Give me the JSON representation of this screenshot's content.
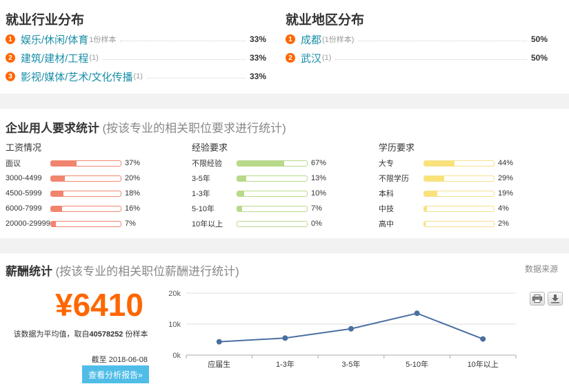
{
  "industry": {
    "title": "就业行业分布",
    "items": [
      {
        "rank": "1",
        "name": "娱乐/休闲/体育",
        "count": "1份样本",
        "pct": "33%"
      },
      {
        "rank": "2",
        "name": "建筑/建材/工程",
        "count": "(1)",
        "pct": "33%"
      },
      {
        "rank": "3",
        "name": "影视/媒体/艺术/文化传播",
        "count": "(1)",
        "pct": "33%"
      }
    ]
  },
  "region": {
    "title": "就业地区分布",
    "items": [
      {
        "rank": "1",
        "name": "成都",
        "count": "(1份样本)",
        "pct": "50%"
      },
      {
        "rank": "2",
        "name": "武汉",
        "count": "(1)",
        "pct": "50%"
      }
    ]
  },
  "requirements": {
    "title": "企业用人要求统计",
    "subtitle": "(按该专业的相关职位要求进行统计)",
    "groups": [
      {
        "title": "工资情况",
        "color": "#f0846e",
        "border": "#f0846e",
        "rows": [
          {
            "label": "面议",
            "value": 37,
            "pct": "37%"
          },
          {
            "label": "3000-4499",
            "value": 20,
            "pct": "20%"
          },
          {
            "label": "4500-5999",
            "value": 18,
            "pct": "18%"
          },
          {
            "label": "6000-7999",
            "value": 16,
            "pct": "16%"
          },
          {
            "label": "20000-29999",
            "value": 7,
            "pct": "7%"
          }
        ]
      },
      {
        "title": "经验要求",
        "color": "#b8d98a",
        "border": "#b8d98a",
        "rows": [
          {
            "label": "不限经验",
            "value": 67,
            "pct": "67%"
          },
          {
            "label": "3-5年",
            "value": 13,
            "pct": "13%"
          },
          {
            "label": "1-3年",
            "value": 10,
            "pct": "10%"
          },
          {
            "label": "5-10年",
            "value": 7,
            "pct": "7%"
          },
          {
            "label": "10年以上",
            "value": 0,
            "pct": "0%"
          }
        ]
      },
      {
        "title": "学历要求",
        "color": "#f9e27a",
        "border": "#f5df8c",
        "rows": [
          {
            "label": "大专",
            "value": 44,
            "pct": "44%"
          },
          {
            "label": "不限学历",
            "value": 29,
            "pct": "29%"
          },
          {
            "label": "本科",
            "value": 19,
            "pct": "19%"
          },
          {
            "label": "中技",
            "value": 4,
            "pct": "4%"
          },
          {
            "label": "高中",
            "value": 2,
            "pct": "2%"
          }
        ]
      }
    ]
  },
  "salary": {
    "title": "薪酬统计",
    "subtitle": "(按该专业的相关职位薪酬进行统计)",
    "source_link": "数据来源",
    "amount": "¥6410",
    "note_prefix": "该数据为平均值，取自",
    "sample_count": "40578252",
    "note_suffix": "份样本",
    "deadline": "截至 2018-06-08",
    "report_button": "查看分析报告»",
    "print_icon": "printer-icon",
    "download_icon": "download-icon"
  },
  "chart_data": {
    "type": "line",
    "categories": [
      "应届生",
      "1-3年",
      "3-5年",
      "5-10年",
      "10年以上"
    ],
    "series": [
      {
        "values": [
          4300,
          5500,
          8500,
          13500,
          5200
        ]
      }
    ],
    "yticks": [
      "0k",
      "10k",
      "20k"
    ],
    "ylim": [
      0,
      20000
    ],
    "line_color": "#4a6fa0",
    "grid": true
  }
}
